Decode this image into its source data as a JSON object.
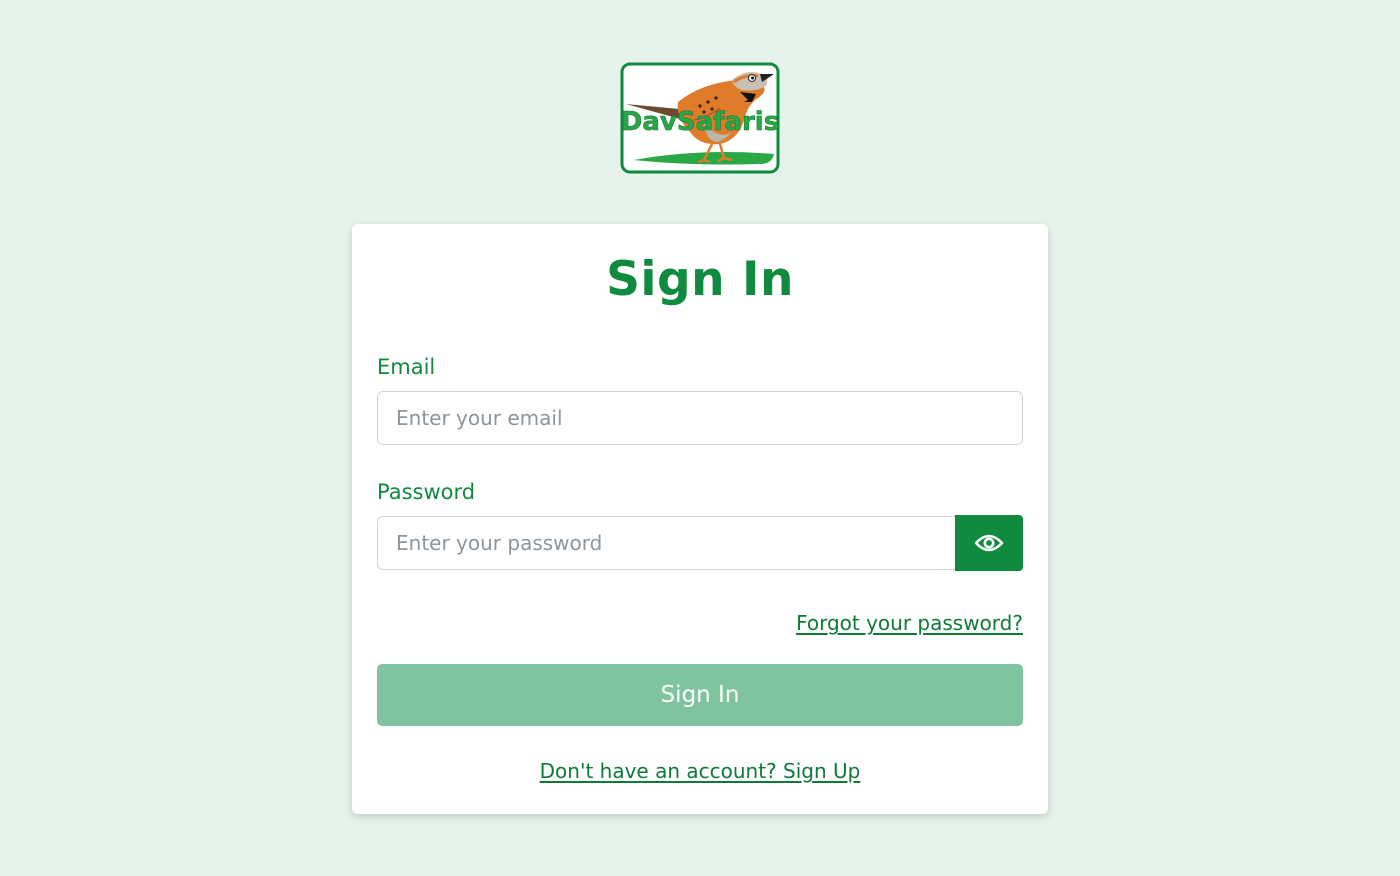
{
  "logo": {
    "text": "DavSafaris",
    "icon": "bird-logo-icon"
  },
  "form": {
    "title": "Sign In",
    "email_label": "Email",
    "email_placeholder": "Enter your email",
    "email_value": "",
    "password_label": "Password",
    "password_placeholder": "Enter your password",
    "password_value": "",
    "toggle_visibility_icon": "eye-icon",
    "forgot_link": "Forgot your password?",
    "submit_label": "Sign In",
    "signup_link": "Don't have an account? Sign Up"
  },
  "colors": {
    "background": "#e5f3eb",
    "brand": "#0f8a3e",
    "button_disabled": "#80c49f"
  }
}
